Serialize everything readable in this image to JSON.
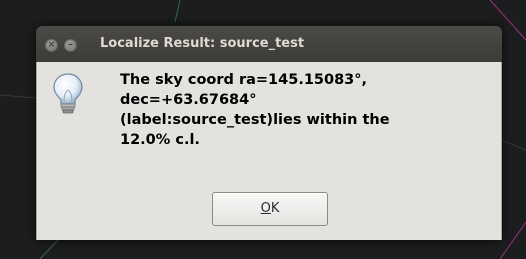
{
  "window": {
    "title": "Localize Result: source_test",
    "buttons": {
      "close_icon": "close-icon",
      "minimize_icon": "minimize-icon",
      "close_glyph": "×",
      "minimize_glyph": "–"
    }
  },
  "dialog": {
    "icon": "lightbulb-info-icon",
    "message": "The sky coord ra=145.15083°,\ndec=+63.67684°\n(label:source_test)lies within the\n12.0% c.l.",
    "ok_button": {
      "mnemonic": "O",
      "rest": "K"
    }
  },
  "colors": {
    "titlebar": "#3c3b37",
    "dialog_bg": "#e4e2de",
    "backdrop": "#1c1d1e"
  }
}
